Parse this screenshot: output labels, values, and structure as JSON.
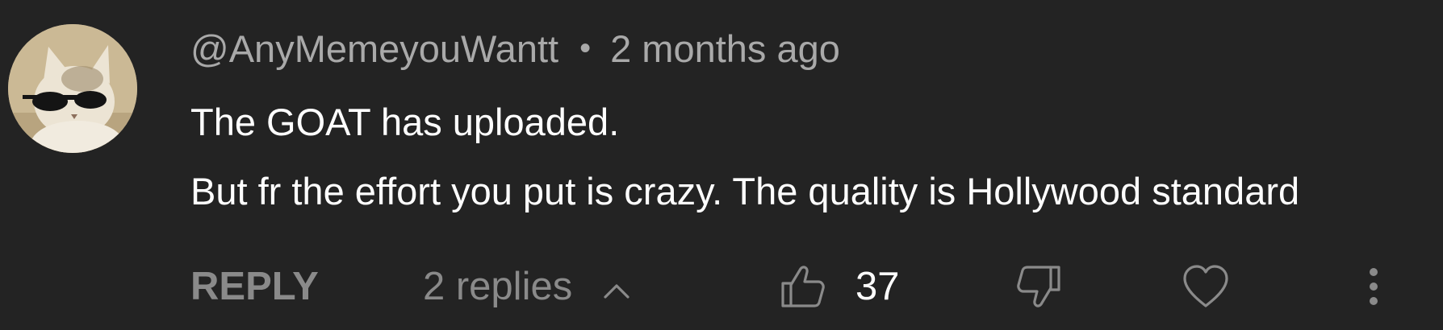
{
  "comment": {
    "author": "@AnyMemeyouWantt",
    "separator": "•",
    "time": "2 months ago",
    "body_lines": [
      "The GOAT has uploaded.",
      "But fr the effort you put is crazy. The quality is Hollywood standard"
    ],
    "avatar_icon": "cat-with-sunglasses-avatar"
  },
  "actions": {
    "reply_label": "REPLY",
    "replies_label": "2 replies",
    "like_count": "37",
    "icons": [
      "chevron-up-icon",
      "thumbs-up-icon",
      "thumbs-down-icon",
      "heart-icon",
      "more-vert-icon"
    ]
  },
  "colors": {
    "background": "#232323",
    "primary_text": "#ffffff",
    "secondary_text": "#a9a9a9",
    "action_text": "#8a8a8a"
  }
}
